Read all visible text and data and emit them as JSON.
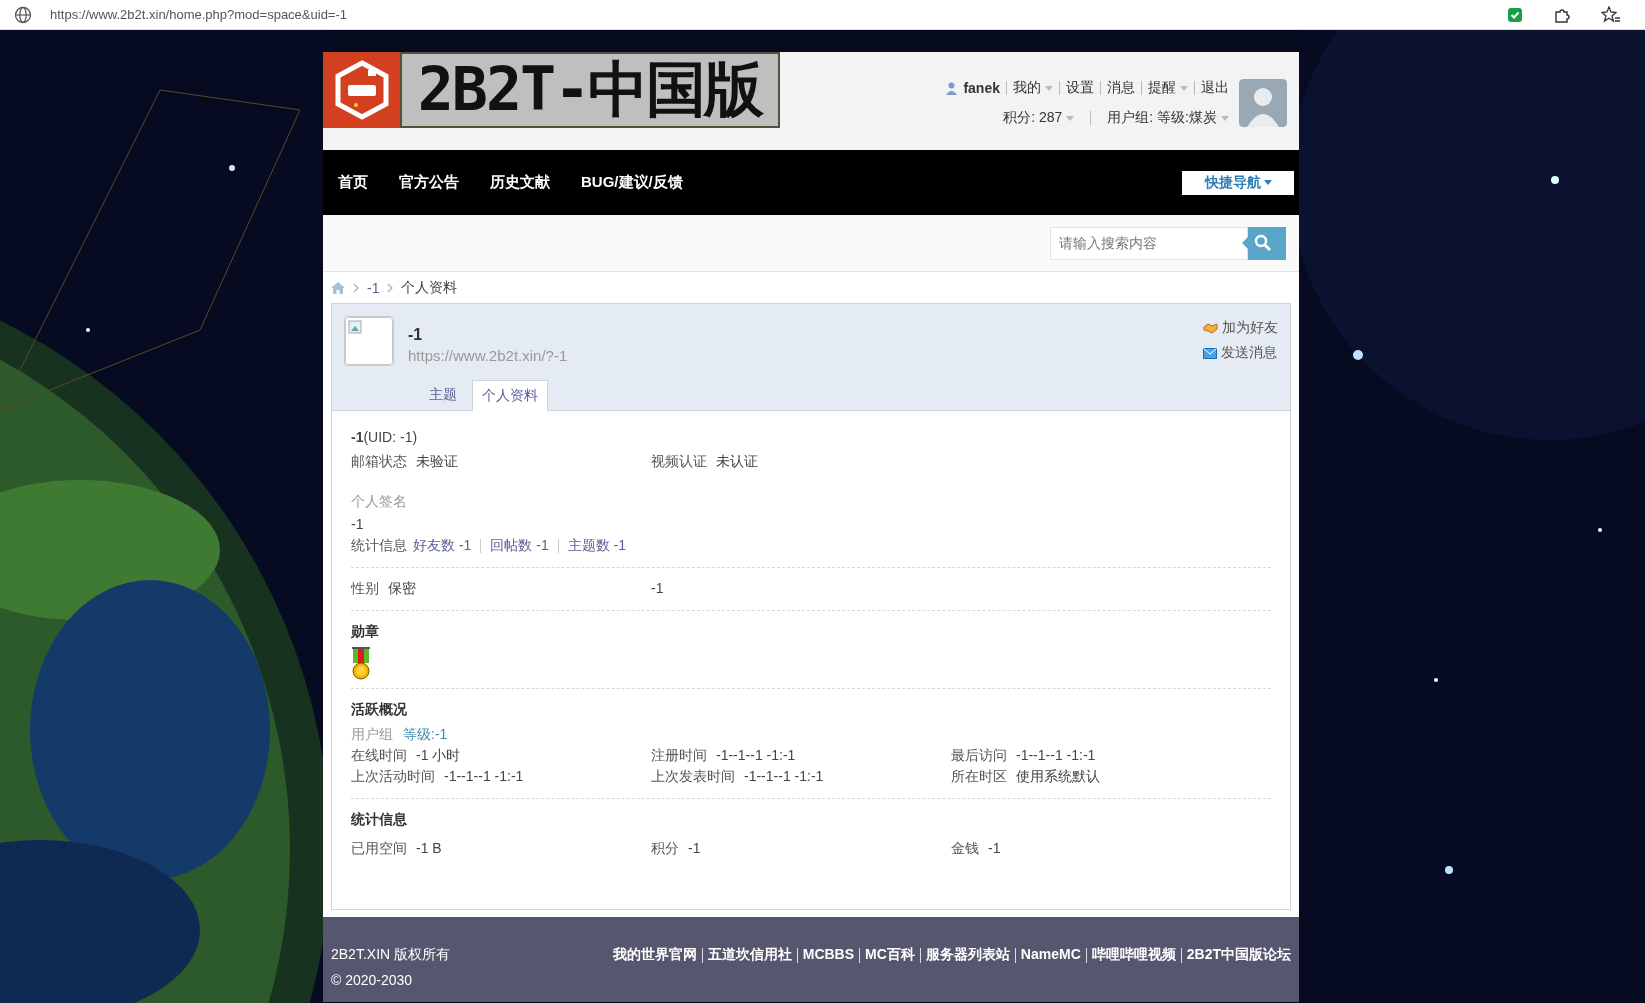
{
  "browser": {
    "url": "https://www.2b2t.xin/home.php?mod=space&uid=-1"
  },
  "header": {
    "logo_text": "2B2T-中国版",
    "user_name": "fanek",
    "user_links": [
      {
        "label": "我的",
        "dropdown": true
      },
      {
        "label": "设置",
        "dropdown": false
      },
      {
        "label": "消息",
        "dropdown": false
      },
      {
        "label": "提醒",
        "dropdown": true
      },
      {
        "label": "退出",
        "dropdown": false
      }
    ],
    "credits": {
      "label": "积分: 287",
      "dropdown": true
    },
    "group": {
      "label": "用户组: 等级:煤炭",
      "dropdown": true
    }
  },
  "nav": {
    "items": [
      "首页",
      "官方公告",
      "历史文献",
      "BUG/建议/反馈"
    ],
    "quick_nav": "快捷导航"
  },
  "search": {
    "placeholder": "请输入搜索内容"
  },
  "breadcrumb": [
    "-1",
    "个人资料"
  ],
  "profile": {
    "name": "-1",
    "url": "https://www.2b2t.xin/?-1",
    "actions": [
      {
        "kind": "friend",
        "label": "加为好友"
      },
      {
        "kind": "message",
        "label": "发送消息"
      }
    ],
    "tabs": [
      {
        "label": "主题",
        "selected": false
      },
      {
        "label": "个人资料",
        "selected": true
      }
    ]
  },
  "details": {
    "uid_line": "**-1**(UID: -1)",
    "verification": [
      {
        "label": "邮箱状态",
        "value": "未验证"
      },
      {
        "label": "视频认证",
        "value": "未认证"
      }
    ],
    "signature_label": "个人签名",
    "signature": "-1",
    "stats_label": "统计信息",
    "stats_links": [
      "好友数 -1",
      "回帖数 -1",
      "主题数 -1"
    ],
    "gender": {
      "label": "性别",
      "value": "保密"
    },
    "column_2": "-1",
    "medals_heading": "勋章",
    "activity_heading": "活跃概况",
    "user_group": {
      "label": "用户组",
      "value": "等级:-1"
    },
    "activity": [
      {
        "label": "在线时间",
        "value": "-1 小时"
      },
      {
        "label": "注册时间",
        "value": "-1--1--1 -1:-1"
      },
      {
        "label": "最后访问",
        "value": "-1--1--1 -1:-1"
      },
      {
        "label": "上次活动时间",
        "value": "-1--1--1 -1:-1"
      },
      {
        "label": "上次发表时间",
        "value": "-1--1--1 -1:-1"
      },
      {
        "label": "所在时区",
        "value": "使用系统默认"
      }
    ],
    "statistics_heading": "统计信息",
    "statistics": [
      {
        "label": "已用空间",
        "value": "-1 B"
      },
      {
        "label": "积分",
        "value": "-1"
      },
      {
        "label": "金钱",
        "value": "-1"
      }
    ]
  },
  "footer": {
    "copyright": "2B2T.XIN 版权所有",
    "years": "© 2020-2030",
    "links": [
      "我的世界官网",
      "五道坎信用社",
      "MCBBS",
      "MC百科",
      "服务器列表站",
      "NameMC",
      "哔哩哔哩视频",
      "2B2T中国版论坛"
    ]
  }
}
